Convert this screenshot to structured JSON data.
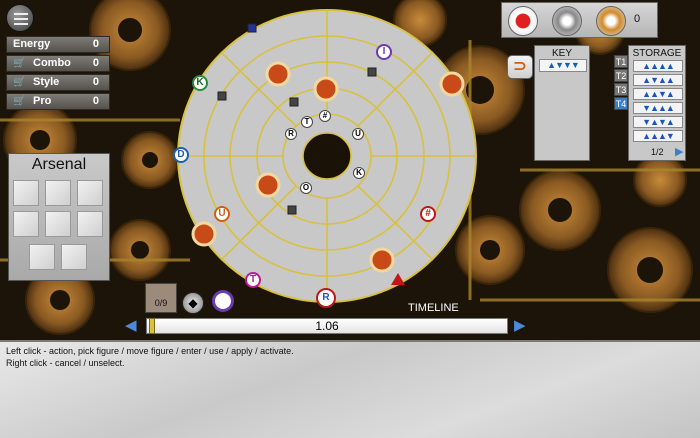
{
  "stats": [
    {
      "label": "Energy",
      "value": "0",
      "icon": null
    },
    {
      "label": "Combo",
      "value": "0",
      "icon": "cart-icon"
    },
    {
      "label": "Style",
      "value": "0",
      "icon": "cart-icon"
    },
    {
      "label": "Pro",
      "value": "0",
      "icon": "cart-icon"
    }
  ],
  "arsenal": {
    "title": "Arsenal"
  },
  "top_counter": "0",
  "key_panel": {
    "title": "KEY",
    "arrows": "▲▼▼▼"
  },
  "storage": {
    "title": "STORAGE",
    "tiers": [
      "T1",
      "T2",
      "T3",
      "T4"
    ],
    "rows": [
      "▲▲▲▲",
      "▲▼▲▲",
      "▲▲▼▲",
      "▼▲▲▲",
      "▼▲▼▲",
      "▲▲▲▼",
      "▼▼▲▲"
    ],
    "page": "1/2"
  },
  "board_tokens": {
    "k1": "K",
    "r1": "R",
    "r2": "R",
    "t1": "T",
    "t2": "T",
    "hash1": "#",
    "hash2": "#",
    "o1": "O",
    "i1": "I",
    "k2": "K",
    "u1": "U",
    "u2": "U",
    "d1": "D"
  },
  "tray": {
    "counter": "0/9"
  },
  "timeline": {
    "label": "TIMELINE",
    "value": "1.06"
  },
  "help": {
    "line1": "Left click - action, pick figure / move figure  / enter / use / apply / activate.",
    "line2": "Right click - cancel / unselect."
  },
  "colors": {
    "board_ring": "#d8c040",
    "board_fill": "#c9c9c9",
    "gear": "#8a5a22",
    "accent": "#3a7fc8"
  }
}
